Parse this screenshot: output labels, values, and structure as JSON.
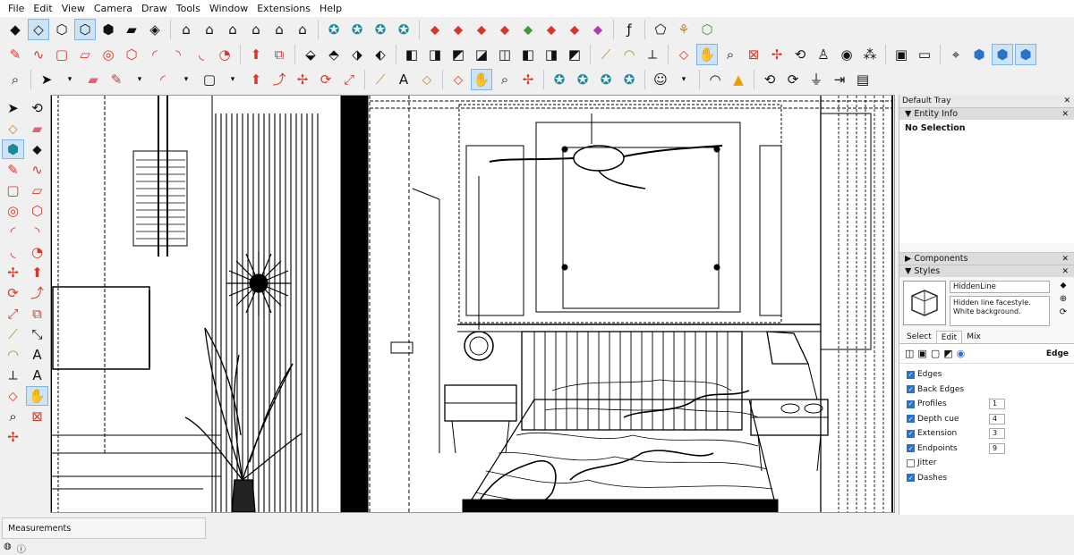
{
  "menu": [
    "File",
    "Edit",
    "View",
    "Camera",
    "Draw",
    "Tools",
    "Window",
    "Extensions",
    "Help"
  ],
  "tray": {
    "title": "Default Tray",
    "entity_info": {
      "header": "Entity Info",
      "selection": "No Selection"
    },
    "components": {
      "header": "Components"
    },
    "styles": {
      "header": "Styles",
      "name": "HiddenLine",
      "description": "Hidden line facestyle. White background.",
      "tabs": [
        "Select",
        "Edit",
        "Mix"
      ],
      "edit_section": "Edge",
      "edges": [
        {
          "label": "Edges",
          "checked": true,
          "value": ""
        },
        {
          "label": "Back Edges",
          "checked": true,
          "value": ""
        },
        {
          "label": "Profiles",
          "checked": true,
          "value": "1"
        },
        {
          "label": "Depth cue",
          "checked": true,
          "value": "4"
        },
        {
          "label": "Extension",
          "checked": true,
          "value": "3"
        },
        {
          "label": "Endpoints",
          "checked": true,
          "value": "9"
        },
        {
          "label": "Jitter",
          "checked": false,
          "value": ""
        },
        {
          "label": "Dashes",
          "checked": true,
          "value": ""
        }
      ]
    }
  },
  "status": {
    "measurements_label": "Measurements"
  },
  "colors": {
    "accent": "#2a72c8",
    "red_tool": "#d9362b",
    "select_bg": "#cde4f7"
  }
}
